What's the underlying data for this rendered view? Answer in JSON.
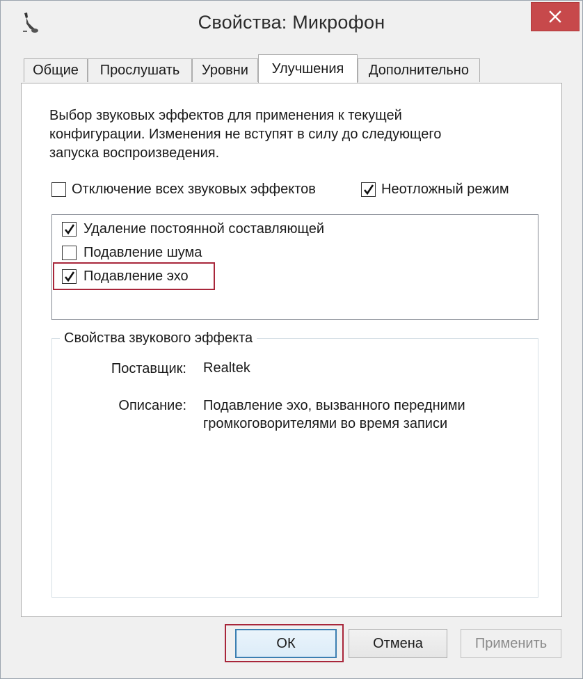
{
  "window": {
    "title": "Свойства: Микрофон",
    "close_label": "✕"
  },
  "tabs": [
    {
      "label": "Общие",
      "active": false
    },
    {
      "label": "Прослушать",
      "active": false
    },
    {
      "label": "Уровни",
      "active": false
    },
    {
      "label": "Улучшения",
      "active": true
    },
    {
      "label": "Дополнительно",
      "active": false
    }
  ],
  "enhancements": {
    "description": "Выбор звуковых эффектов для применения к текущей конфигурации. Изменения не вступят в силу до следующего запуска воспроизведения.",
    "disable_all": {
      "label": "Отключение всех звуковых эффектов",
      "checked": false
    },
    "immediate_mode": {
      "label": "Неотложный режим",
      "checked": true
    },
    "effects": [
      {
        "label": "Удаление постоянной составляющей",
        "checked": true
      },
      {
        "label": "Подавление шума",
        "checked": false
      },
      {
        "label": "Подавление эхо",
        "checked": true
      }
    ]
  },
  "effect_properties": {
    "title": "Свойства звукового эффекта",
    "provider_label": "Поставщик:",
    "provider_value": "Realtek",
    "description_label": "Описание:",
    "description_value": "Подавление эхо, вызванного передними громкоговорителями во время записи"
  },
  "buttons": {
    "ok": "ОК",
    "cancel": "Отмена",
    "apply": "Применить"
  },
  "colors": {
    "close_button": "#c7494b",
    "highlight_border": "#a8263a"
  },
  "icons": {
    "app": "microphone-icon",
    "close": "close-icon",
    "checkmark": "checkmark-icon"
  }
}
